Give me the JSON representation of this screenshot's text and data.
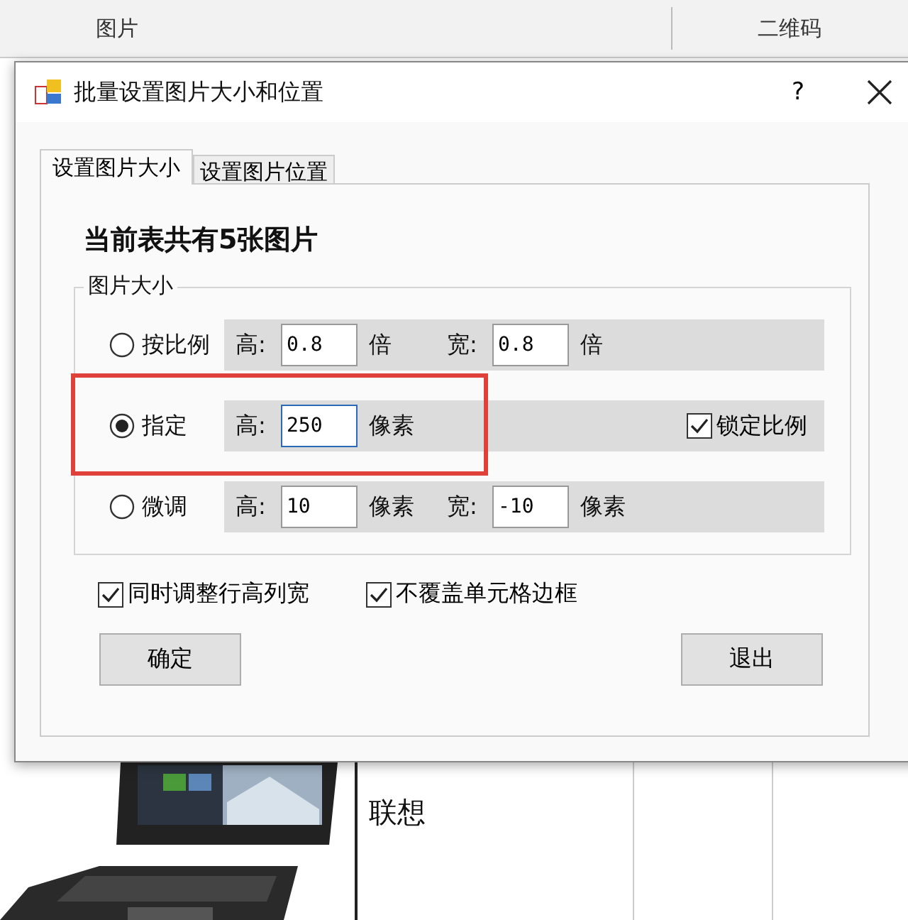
{
  "sheet": {
    "headers": [
      {
        "label": "图片"
      },
      {
        "label": "二维码"
      }
    ],
    "cell": "联想"
  },
  "dialog": {
    "title": "批量设置图片大小和位置",
    "help": "?",
    "tabs": [
      {
        "label": "设置图片大小",
        "selected": true
      },
      {
        "label": "设置图片位置",
        "selected": false
      }
    ],
    "summary": "当前表共有5张图片",
    "group": {
      "legend": "图片大小",
      "options": [
        {
          "kind": "scale",
          "label": "按比例",
          "selected": false,
          "fields": [
            {
              "label": "高:",
              "value": "0.8",
              "unit": "倍",
              "focused": false
            },
            {
              "label": "宽:",
              "value": "0.8",
              "unit": "倍",
              "focused": false
            }
          ]
        },
        {
          "kind": "fixed",
          "label": "指定",
          "selected": true,
          "highlighted": true,
          "fields": [
            {
              "label": "高:",
              "value": "250",
              "unit": "像素",
              "focused": true
            }
          ],
          "lock": {
            "label": "锁定比例",
            "checked": true
          }
        },
        {
          "kind": "adjust",
          "label": "微调",
          "selected": false,
          "fields": [
            {
              "label": "高:",
              "value": "10",
              "unit": "像素",
              "focused": false
            },
            {
              "label": "宽:",
              "value": "-10",
              "unit": "像素",
              "focused": false
            }
          ]
        }
      ]
    },
    "checkboxes": [
      {
        "label": "同时调整行高列宽",
        "checked": true
      },
      {
        "label": "不覆盖单元格边框",
        "checked": true
      }
    ],
    "buttons": [
      {
        "label": "确定"
      },
      {
        "label": "退出"
      }
    ]
  }
}
